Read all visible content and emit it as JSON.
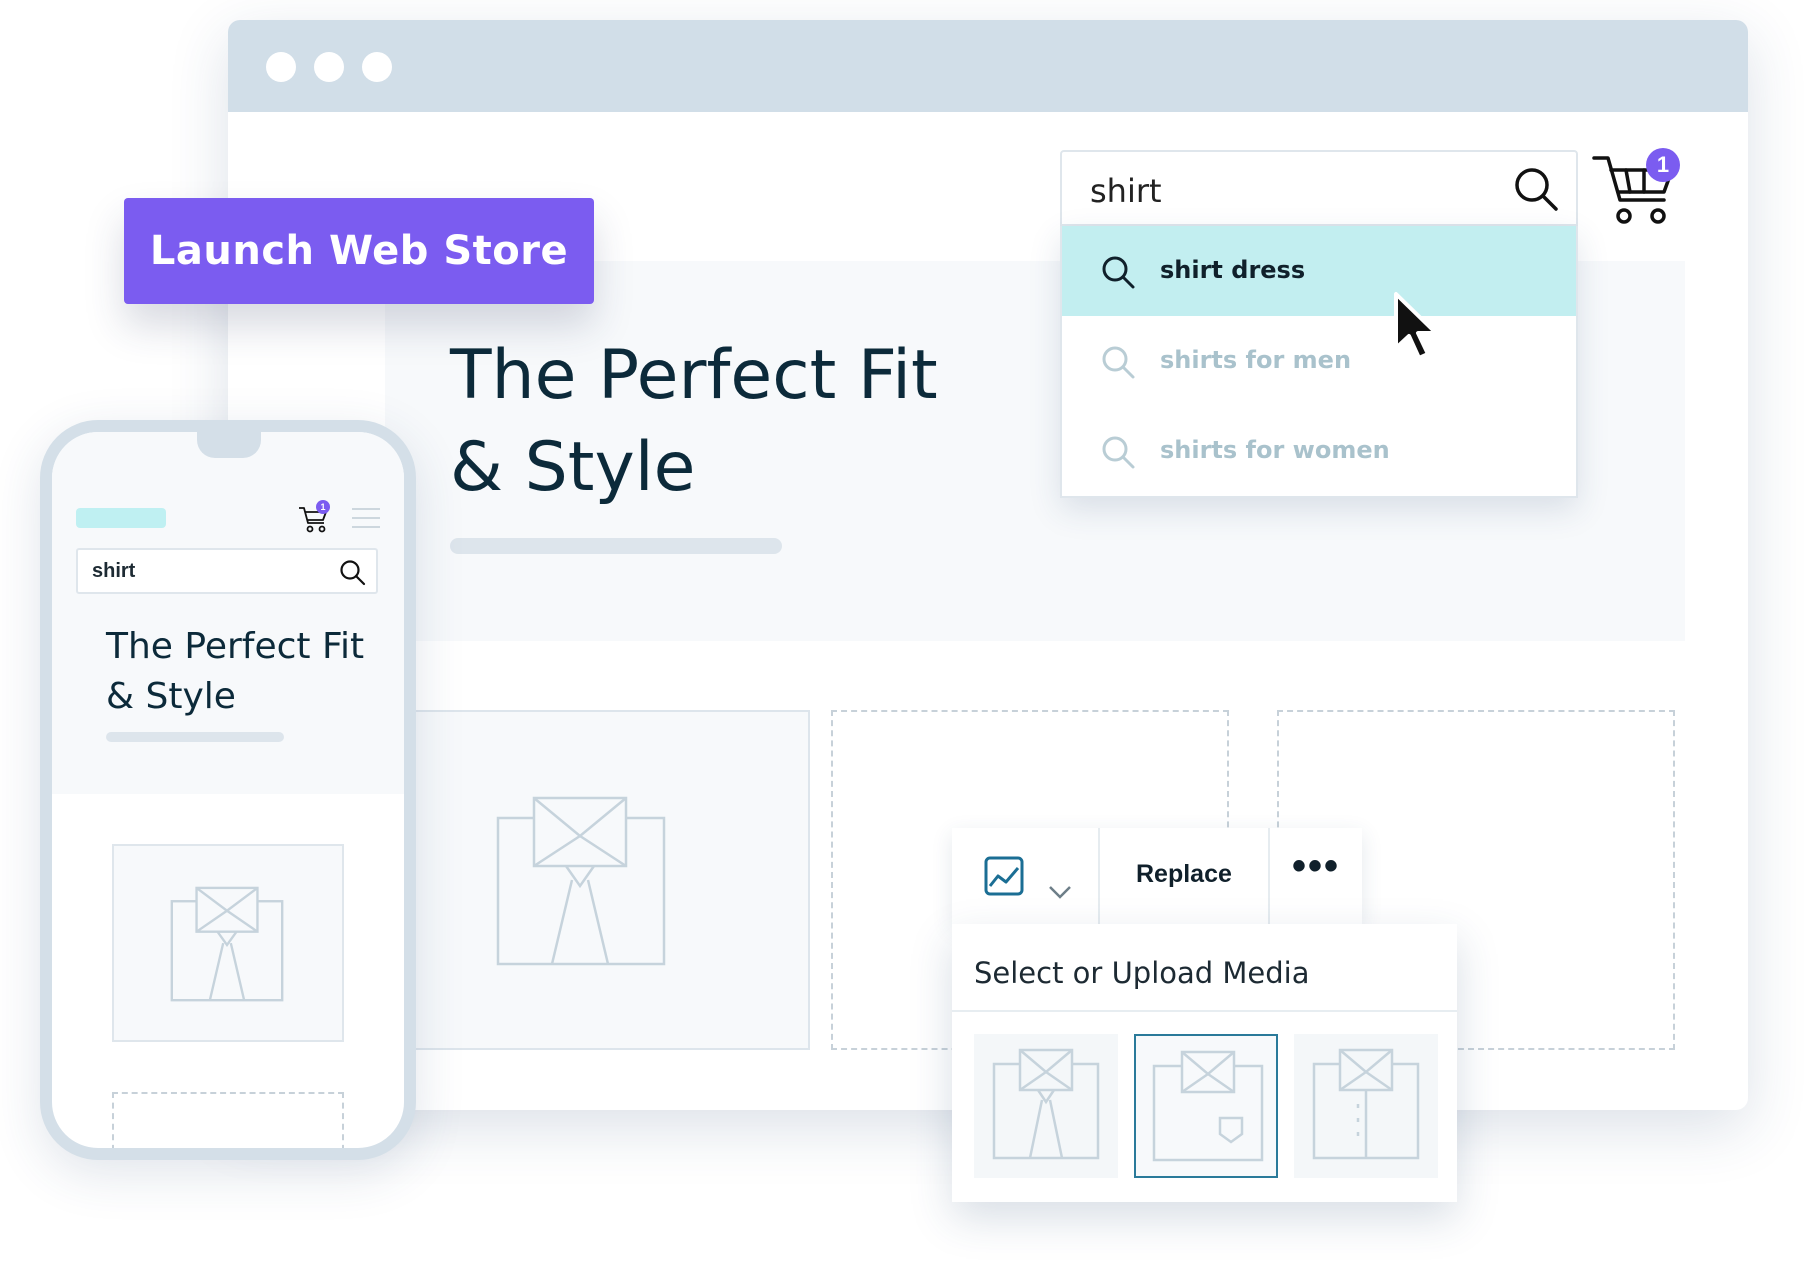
{
  "launch_button": {
    "label": "Launch Web Store"
  },
  "hero": {
    "title": "The Perfect Fit\n& Style"
  },
  "search": {
    "value": "shirt",
    "suggestions": [
      {
        "label": "shirt dress",
        "active": true
      },
      {
        "label": "shirts for men"
      },
      {
        "label": "shirts for women"
      }
    ]
  },
  "cart": {
    "count": "1"
  },
  "media_toolbar": {
    "replace_label": "Replace",
    "more_label": "•••",
    "panel_title": "Select or Upload Media"
  },
  "phone": {
    "search_value": "shirt",
    "title": "The Perfect Fit\n& Style",
    "cart_count": "1"
  },
  "colors": {
    "accent": "#7b5cf0",
    "highlight": "#c2eef0",
    "titlebar": "#d1dee8",
    "selected_thumb": "#2a7a9a"
  },
  "icons": [
    "search-icon",
    "cart-icon",
    "image-icon",
    "chevron-down-icon",
    "more-icon",
    "hamburger-menu-icon",
    "cursor-arrow-icon",
    "shirt-illustration-icon"
  ]
}
